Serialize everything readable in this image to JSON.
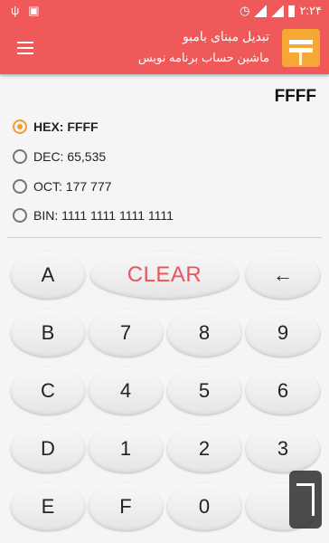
{
  "statusbar": {
    "time": "۲:۲۴",
    "icons": [
      "usb-icon",
      "android-icon",
      "alarm-icon",
      "signal-icon",
      "signal-icon",
      "battery-icon"
    ]
  },
  "appbar": {
    "title": "تبدیل مبنای بامبو",
    "subtitle": "ماشین حساب برنامه نویس"
  },
  "display": {
    "value": "FFFF"
  },
  "modes": [
    {
      "label": "HEX: FFFF",
      "checked": true
    },
    {
      "label": "DEC: 65,535",
      "checked": false
    },
    {
      "label": "OCT: 177 777",
      "checked": false
    },
    {
      "label": "BIN: 1111 1111 1111 1111",
      "checked": false
    }
  ],
  "keys": {
    "a": "A",
    "clear": "CLEAR",
    "back": "←",
    "b": "B",
    "k7": "7",
    "k8": "8",
    "k9": "9",
    "c": "C",
    "k4": "4",
    "k5": "5",
    "k6": "6",
    "d": "D",
    "k1": "1",
    "k2": "2",
    "k3": "3",
    "e": "E",
    "f": "F",
    "k0": "0"
  },
  "colors": {
    "primary": "#f0595a",
    "accent": "#f29c38",
    "logo": "#f7a733",
    "clear_text": "#e8555a"
  }
}
